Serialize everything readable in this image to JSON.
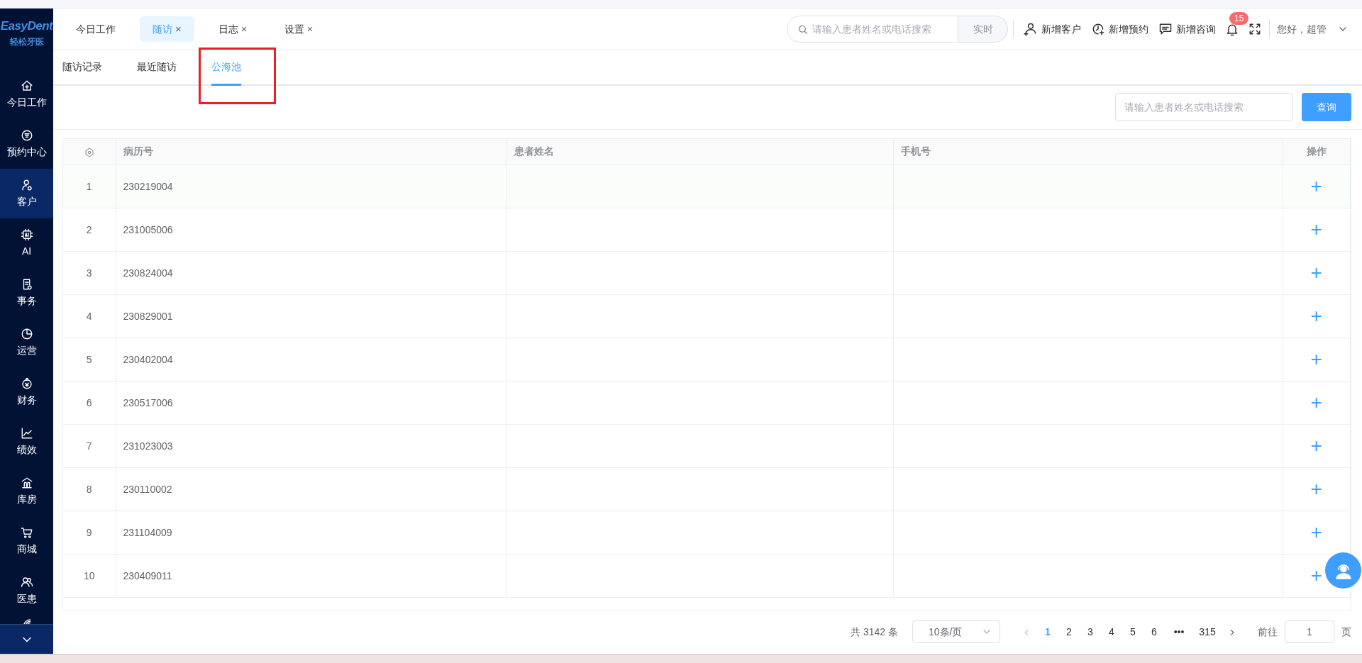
{
  "sidebar": {
    "logo": "EasyDent",
    "logo_subtitle": "轻松牙医",
    "items": [
      {
        "label": "今日工作",
        "selected": false
      },
      {
        "label": "预约中心",
        "selected": false
      },
      {
        "label": "客户",
        "selected": true
      },
      {
        "label": "AI",
        "selected": false
      },
      {
        "label": "事务",
        "selected": false
      },
      {
        "label": "运营",
        "selected": false
      },
      {
        "label": "财务",
        "selected": false
      },
      {
        "label": "绩效",
        "selected": false
      },
      {
        "label": "库房",
        "selected": false
      },
      {
        "label": "商城",
        "selected": false
      },
      {
        "label": "医患",
        "selected": false
      }
    ]
  },
  "tabs": [
    {
      "label": "今日工作",
      "selected": false
    },
    {
      "label": "随访",
      "selected": true,
      "close": "×"
    },
    {
      "label": "日志",
      "selected": false,
      "close": "×"
    },
    {
      "label": "设置",
      "selected": false,
      "close": "×"
    }
  ],
  "header": {
    "search": {
      "placeholder": "请输入患者姓名或电话搜索",
      "button": "实时"
    },
    "actions": [
      "新增客户",
      "新增预约",
      "新增咨询"
    ],
    "notification_count": "15",
    "user": "您好，超管"
  },
  "subtabs": [
    {
      "label": "随访记录",
      "selected": false
    },
    {
      "label": "最近随访",
      "selected": false
    },
    {
      "label": "公海池",
      "selected": true
    }
  ],
  "filter": {
    "placeholder": "请输入患者姓名或电话搜索",
    "button": "查询"
  },
  "table": {
    "columns": [
      "病历号",
      "患者姓名",
      "手机号",
      "操作"
    ],
    "rows": [
      {
        "index": "1",
        "record_no": "230219004",
        "action": "+"
      },
      {
        "index": "2",
        "record_no": "231005006",
        "action": "+"
      },
      {
        "index": "3",
        "record_no": "230824004",
        "action": "+"
      },
      {
        "index": "4",
        "record_no": "230829001",
        "action": "+"
      },
      {
        "index": "5",
        "record_no": "230402004",
        "action": "+"
      },
      {
        "index": "6",
        "record_no": "230517006",
        "action": "+"
      },
      {
        "index": "7",
        "record_no": "231023003",
        "action": "+"
      },
      {
        "index": "8",
        "record_no": "230110002",
        "action": "+"
      },
      {
        "index": "9",
        "record_no": "231104009",
        "action": "+"
      },
      {
        "index": "10",
        "record_no": "230409011",
        "action": "+"
      }
    ]
  },
  "pagination": {
    "total": "共 3142 条",
    "page_size": "10条/页",
    "pages": [
      {
        "label": "1",
        "selected": true
      },
      {
        "label": "2",
        "selected": false
      },
      {
        "label": "3",
        "selected": false
      },
      {
        "label": "4",
        "selected": false
      },
      {
        "label": "5",
        "selected": false
      },
      {
        "label": "6",
        "selected": false
      },
      {
        "label": "•••",
        "selected": false
      },
      {
        "label": "315",
        "selected": false
      }
    ],
    "goto_label": "前往",
    "goto_value": "1",
    "goto_suffix": "页"
  }
}
